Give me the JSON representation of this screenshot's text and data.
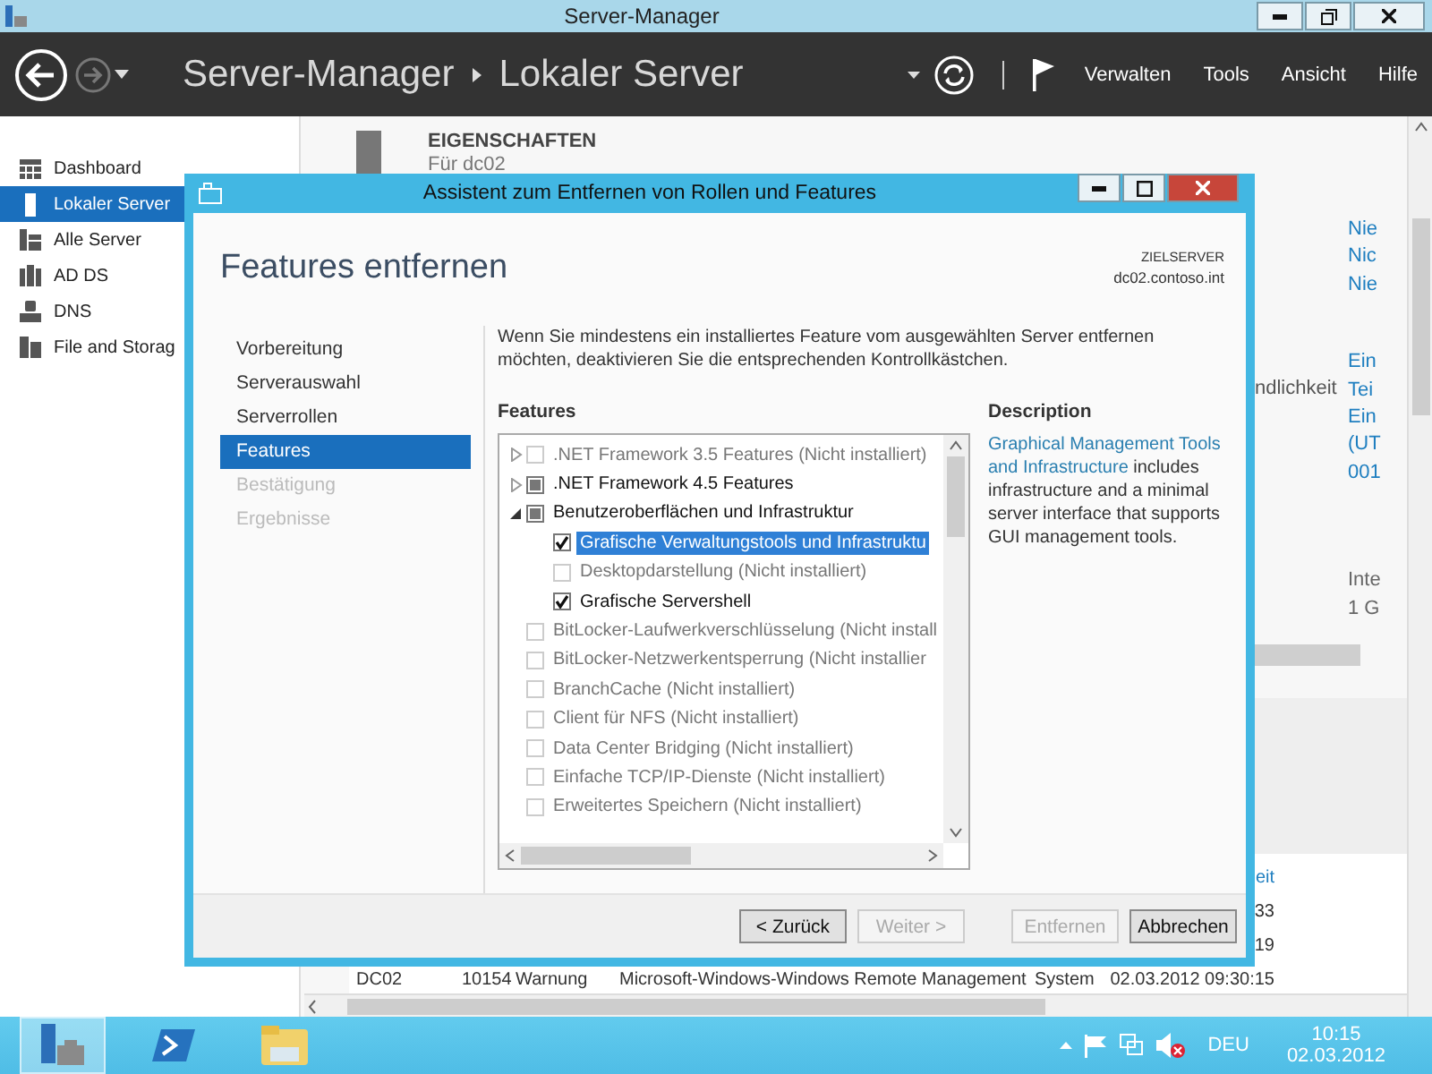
{
  "window": {
    "title": "Server-Manager"
  },
  "header": {
    "breadcrumb": [
      "Server-Manager",
      "Lokaler Server"
    ],
    "menu": [
      "Verwalten",
      "Tools",
      "Ansicht",
      "Hilfe"
    ]
  },
  "sidebar": {
    "items": [
      {
        "label": "Dashboard",
        "kind": "dashboard",
        "selected": false
      },
      {
        "label": "Lokaler Server",
        "kind": "server",
        "selected": true
      },
      {
        "label": "Alle Server",
        "kind": "servers",
        "selected": false
      },
      {
        "label": "AD DS",
        "kind": "directory",
        "selected": false
      },
      {
        "label": "DNS",
        "kind": "dns",
        "selected": false
      },
      {
        "label": "File and Storag",
        "kind": "storage",
        "selected": false
      }
    ]
  },
  "properties": {
    "title": "EIGENSCHAFTEN",
    "subtitle": "Für dc02",
    "label_fragment": "ndlichkeit",
    "value_groups": [
      {
        "link": true,
        "values": [
          "Nie",
          "Nic",
          "Nie"
        ]
      },
      {
        "link": true,
        "values": [
          "Ein",
          "Tei",
          "Ein",
          "(UT",
          "001"
        ]
      },
      {
        "link": false,
        "values": [
          "Inte",
          "1 G"
        ]
      }
    ]
  },
  "events_table": {
    "header": {
      "column_6": "eit"
    },
    "rows": [
      {
        "column_6": "33"
      },
      {
        "column_6": "19"
      },
      {
        "column_1": "DC02",
        "column_2": "10154",
        "column_3": "Warnung",
        "column_4": "Microsoft-Windows-Windows Remote Management",
        "column_5": "System",
        "column_6": "02.03.2012 09:30:15"
      }
    ]
  },
  "dialog": {
    "title": "Assistent zum Entfernen von Rollen und Features",
    "heading": "Features entfernen",
    "target_label": "ZIELSERVER",
    "target": "dc02.contoso.int",
    "steps": [
      {
        "label": "Vorbereitung",
        "selected": false,
        "disabled": false
      },
      {
        "label": "Serverauswahl",
        "selected": false,
        "disabled": false
      },
      {
        "label": "Serverrollen",
        "selected": false,
        "disabled": false
      },
      {
        "label": "Features",
        "selected": true,
        "disabled": false
      },
      {
        "label": "Bestätigung",
        "selected": false,
        "disabled": true
      },
      {
        "label": "Ergebnisse",
        "selected": false,
        "disabled": true
      }
    ],
    "instruction": "Wenn Sie mindestens ein installiertes Feature vom ausgewählten Server entfernen möchten, deaktivieren Sie die entsprechenden Kontrollkästchen.",
    "features_label": "Features",
    "features": [
      {
        "label": ".NET Framework 3.5 Features (Nicht installiert)",
        "checked": false,
        "partial": false,
        "disabled": true,
        "expanded": false,
        "selected": false
      },
      {
        "label": ".NET Framework 4.5 Features",
        "checked": false,
        "partial": true,
        "disabled": false,
        "expanded": false,
        "selected": false
      },
      {
        "label": "Benutzeroberflächen und Infrastruktur",
        "checked": false,
        "partial": true,
        "disabled": false,
        "expanded": true,
        "selected": false,
        "children": [
          {
            "label": "Grafische Verwaltungstools und Infrastruktu",
            "checked": true,
            "partial": false,
            "disabled": false,
            "selected": true
          },
          {
            "label": "Desktopdarstellung (Nicht installiert)",
            "checked": false,
            "partial": false,
            "disabled": true,
            "selected": false
          },
          {
            "label": "Grafische Servershell",
            "checked": true,
            "partial": false,
            "disabled": false,
            "selected": false
          }
        ]
      },
      {
        "label": "BitLocker-Laufwerkverschlüsselung (Nicht install",
        "checked": false,
        "partial": false,
        "disabled": true,
        "selected": false
      },
      {
        "label": "BitLocker-Netzwerkentsperrung (Nicht installier",
        "checked": false,
        "partial": false,
        "disabled": true,
        "selected": false
      },
      {
        "label": "BranchCache (Nicht installiert)",
        "checked": false,
        "partial": false,
        "disabled": true,
        "selected": false
      },
      {
        "label": "Client für NFS (Nicht installiert)",
        "checked": false,
        "partial": false,
        "disabled": true,
        "selected": false
      },
      {
        "label": "Data Center Bridging (Nicht installiert)",
        "checked": false,
        "partial": false,
        "disabled": true,
        "selected": false
      },
      {
        "label": "Einfache TCP/IP-Dienste (Nicht installiert)",
        "checked": false,
        "partial": false,
        "disabled": true,
        "selected": false
      },
      {
        "label": "Erweitertes Speichern (Nicht installiert)",
        "checked": false,
        "partial": false,
        "disabled": true,
        "selected": false
      }
    ],
    "description_label": "Description",
    "description": {
      "link": "Graphical Management Tools and Infrastructure",
      "text": " includes infrastructure and a minimal server interface that supports GUI management tools."
    },
    "buttons": [
      {
        "label": "< Zurück",
        "disabled": false
      },
      {
        "label": "Weiter >",
        "disabled": true
      },
      {
        "label": "Entfernen",
        "disabled": true
      },
      {
        "label": "Abbrechen",
        "disabled": false
      }
    ]
  },
  "taskbar": {
    "apps": [
      {
        "kind": "server-manager",
        "selected": true
      },
      {
        "kind": "powershell",
        "selected": false
      },
      {
        "kind": "explorer",
        "selected": false
      }
    ],
    "language": "DEU",
    "time": "10:15",
    "date": "02.03.2012"
  }
}
